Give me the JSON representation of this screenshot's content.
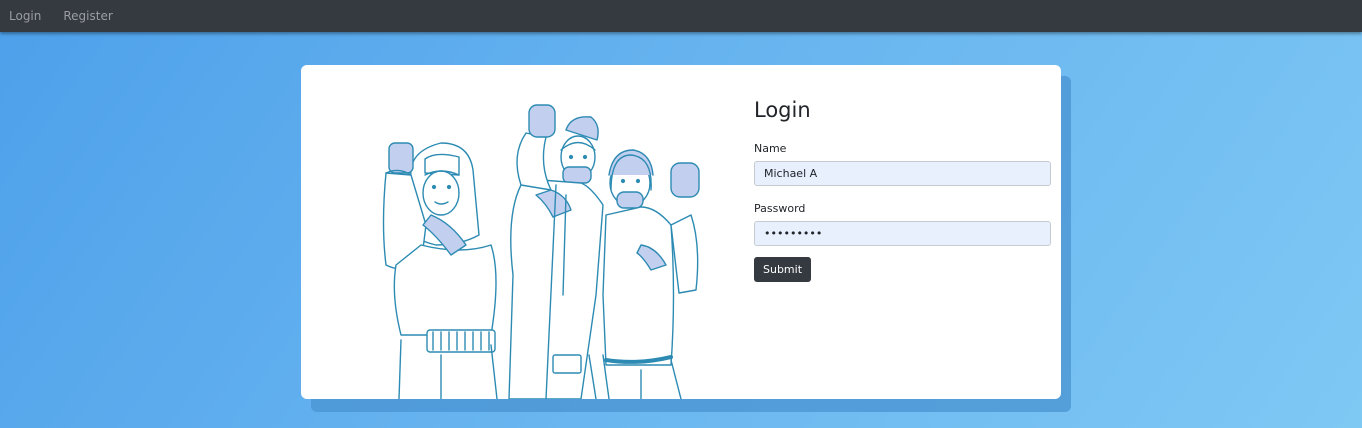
{
  "nav": {
    "login_label": "Login",
    "register_label": "Register"
  },
  "form": {
    "title": "Login",
    "name_label": "Name",
    "name_value": "Michael A",
    "password_label": "Password",
    "password_value": "•••••••••",
    "submit_label": "Submit"
  },
  "colors": {
    "navbar": "#343a40",
    "background_start": "#4da0ea",
    "background_end": "#7ec8f4",
    "illustration_stroke": "#2d8bb3",
    "illustration_fill": "#c3cfef"
  }
}
